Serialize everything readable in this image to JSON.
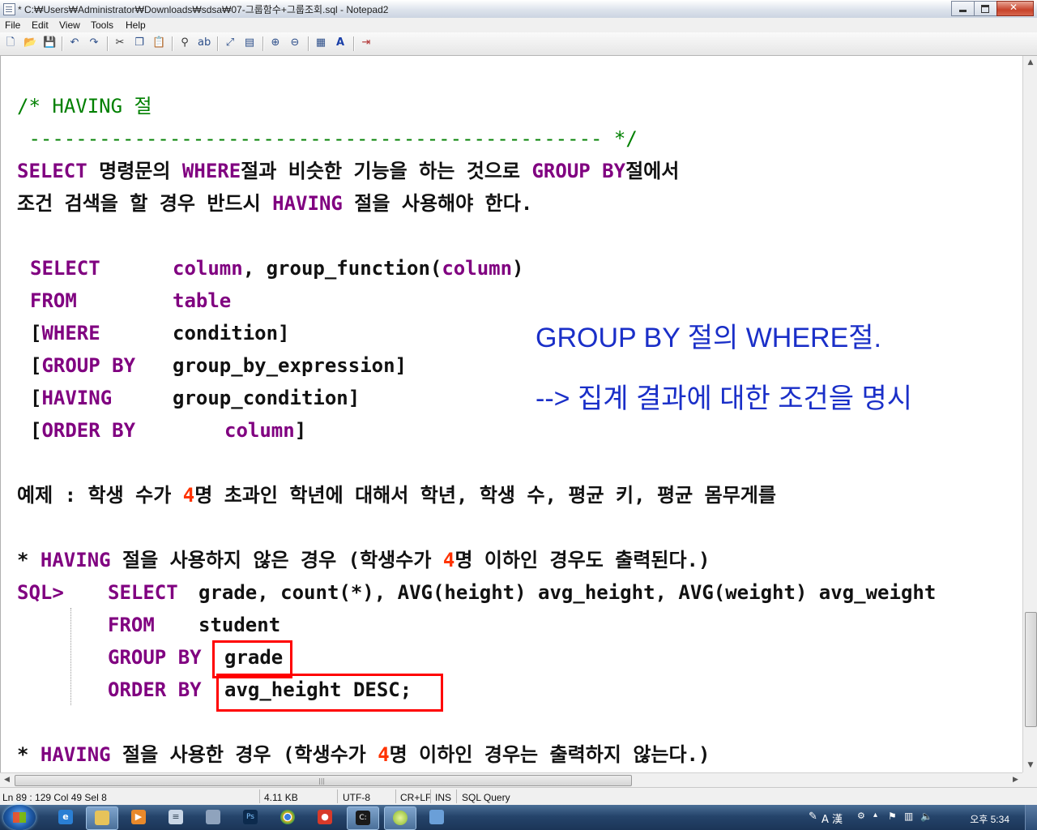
{
  "window": {
    "title": "* C:₩Users₩Administrator₩Downloads₩sdsa₩07-그룹함수+그룹조회.sql - Notepad2"
  },
  "menu": [
    "File",
    "Edit",
    "View",
    "Tools",
    "Help"
  ],
  "toolbar": {
    "icons": [
      "new-file-icon",
      "open-file-icon",
      "save-icon",
      "undo-icon",
      "redo-icon",
      "cut-icon",
      "copy-icon",
      "paste-icon",
      "find-icon",
      "replace-icon",
      "goto-icon",
      "toggle-view-icon",
      "zoom-in-icon",
      "zoom-out-icon",
      "scheme-icon",
      "font-icon",
      "exit-icon"
    ]
  },
  "editor": {
    "lines": {
      "l1_comment": "/* HAVING 절",
      "l2_comment": " ------------------------------------------------- */",
      "l3_kw1": "SELECT",
      "l3_t1": " 명령문의 ",
      "l3_kw2": "WHERE",
      "l3_t2": "절과 비슷한 기능을 하는 것으로 ",
      "l3_kw3": "GROUP BY",
      "l3_t3": "절에서",
      "l4_t1": "조건 검색을 할 경우 반드시 ",
      "l4_kw1": "HAVING",
      "l4_t2": " 절을 사용해야 한다.",
      "s1_kw": "SELECT",
      "s1_a": "column",
      "s1_b": ", group_function(",
      "s1_c": "column",
      "s1_d": ")",
      "s2_kw": "FROM",
      "s2_a": "table",
      "s3_br": "[",
      "s3_kw": "WHERE",
      "s3_a": "condition]",
      "s4_br": "[",
      "s4_kw": "GROUP BY",
      "s4_a": "group_by_expression]",
      "s5_br": "[",
      "s5_kw": "HAVING",
      "s5_a": "group_condition]",
      "s6_br": "[",
      "s6_kw": "ORDER BY",
      "s6_a": "column",
      "s6_b": "]",
      "ex_t1": "예제 : 학생 수가 ",
      "ex_num": "4",
      "ex_t2": "명 초과인 학년에 대해서 학년, 학생 수, 평균 키, 평균 몸무게를",
      "h1_star": "* ",
      "h1_kw": "HAVING",
      "h1_t1": " 절을 사용하지 않은 경우 (학생수가 ",
      "h1_num": "4",
      "h1_t2": "명 이하인 경우도 출력된다.)",
      "q1_prompt": "SQL>",
      "q1_kw": "SELECT",
      "q1_a": "grade, count(*), AVG(height) avg_height, AVG(weight) avg_weight",
      "q2_kw": "FROM",
      "q2_a": "student",
      "q3_kw": "GROUP BY",
      "q3_a": "grade",
      "q4_kw": "ORDER BY",
      "q4_a": "avg_height DESC;",
      "h2_star": "* ",
      "h2_kw": "HAVING",
      "h2_t1": " 절을 사용한 경우 (학생수가 ",
      "h2_num": "4",
      "h2_t2": "명 이하인 경우는 출력하지 않는다.)"
    },
    "annotation": {
      "line1": "GROUP BY 절의 WHERE절.",
      "line2": "--> 집계 결과에 대한 조건을 명시"
    }
  },
  "statusbar": {
    "position": "Ln 89 : 129   Col 49   Sel 8",
    "size": "4.11 KB",
    "encoding": "UTF-8",
    "eol": "CR+LF",
    "mode": "INS",
    "scheme": "SQL Query"
  },
  "taskbar": {
    "tray_text": "A 漢",
    "clock": "오후 5:34"
  },
  "colors": {
    "comment": "#008000",
    "keyword": "#800080",
    "number": "#ff3300",
    "annotation": "#1a2fc8",
    "highlight_box": "#ff0000"
  }
}
